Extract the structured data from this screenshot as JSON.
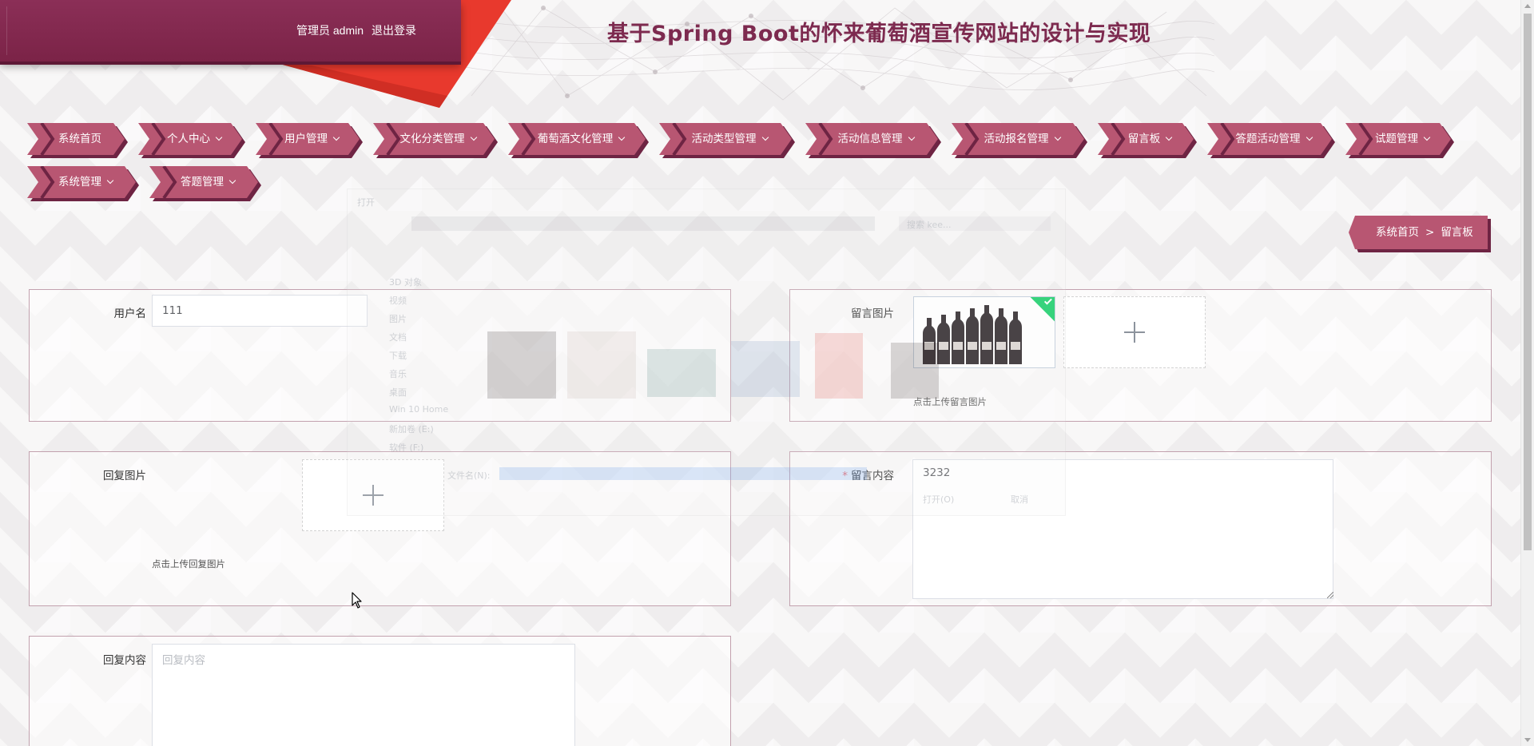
{
  "header": {
    "user_label": "管理员 admin",
    "logout_label": "退出登录",
    "site_title": "基于Spring Boot的怀来葡萄酒宣传网站的设计与实现"
  },
  "nav": {
    "items": [
      {
        "label": "系统首页",
        "has_caret": false
      },
      {
        "label": "个人中心",
        "has_caret": true
      },
      {
        "label": "用户管理",
        "has_caret": true
      },
      {
        "label": "文化分类管理",
        "has_caret": true
      },
      {
        "label": "葡萄酒文化管理",
        "has_caret": true
      },
      {
        "label": "活动类型管理",
        "has_caret": true
      },
      {
        "label": "活动信息管理",
        "has_caret": true
      },
      {
        "label": "活动报名管理",
        "has_caret": true
      },
      {
        "label": "留言板",
        "has_caret": true
      },
      {
        "label": "答题活动管理",
        "has_caret": true
      },
      {
        "label": "试题管理",
        "has_caret": true
      },
      {
        "label": "系统管理",
        "has_caret": true
      },
      {
        "label": "答题管理",
        "has_caret": true
      }
    ]
  },
  "breadcrumb": {
    "home": "系统首页",
    "separator": ">",
    "current": "留言板"
  },
  "form": {
    "username": {
      "label": "用户名",
      "value": "111"
    },
    "message_image": {
      "label": "留言图片",
      "hint": "点击上传留言图片"
    },
    "reply_image": {
      "label": "回复图片",
      "hint": "点击上传回复图片"
    },
    "message_content": {
      "label": "留言内容",
      "required_mark": "*",
      "value": "3232"
    },
    "reply_content": {
      "label": "回复内容",
      "placeholder": "回复内容"
    }
  },
  "ghost_dialog": {
    "title": "打开",
    "filename_label": "文件名(N):",
    "open_button": "打开(O)",
    "cancel_button": "取消",
    "search_placeholder": "搜索 kee...",
    "sidebar": [
      "3D 对象",
      "视频",
      "图片",
      "文档",
      "下载",
      "音乐",
      "桌面",
      "Win 10 Home",
      "新加卷 (E:)",
      "软件 (F:)"
    ]
  },
  "colors": {
    "brand": "#7d2a4f",
    "nav_fill": "#b85672",
    "nav_shadow": "#6e2443",
    "accent_red": "#e8392d",
    "success": "#13ce66"
  }
}
